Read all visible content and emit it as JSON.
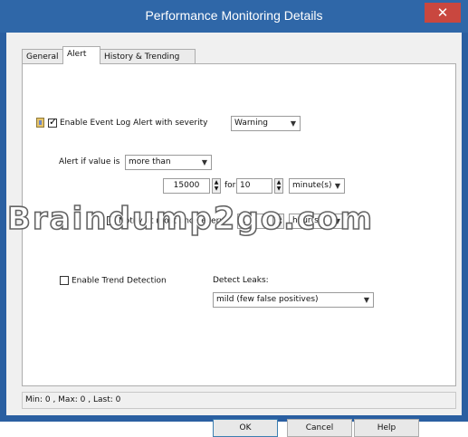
{
  "window": {
    "title": "Performance Monitoring Details",
    "close_glyph": "✕"
  },
  "tabs": [
    {
      "label": "General",
      "active": false
    },
    {
      "label": "Alert",
      "active": true
    },
    {
      "label": "History & Trending",
      "active": false
    }
  ],
  "alert": {
    "event_log_checkbox_label": "Enable Event Log Alert with severity",
    "event_log_checked": true,
    "severity_value": "Warning",
    "alert_if_label": "Alert if value is",
    "comparator_value": "more than",
    "threshold_value": "15000",
    "for_label": "for",
    "duration_value": "10",
    "duration_unit": "minute(s)",
    "notify_label": "Notify at most once every",
    "notify_checked": true,
    "notify_value": "1",
    "notify_unit": "hour(s)",
    "trend_label": "Enable Trend Detection",
    "trend_checked": false,
    "detect_leaks_label": "Detect Leaks:",
    "detect_leaks_value": "mild (few false positives)"
  },
  "watermark": "Braindump2go.com",
  "status": {
    "text": "Min: 0 , Max: 0 , Last: 0"
  },
  "buttons": {
    "ok": "OK",
    "cancel": "Cancel",
    "help": "Help"
  },
  "colors": {
    "titlebar": "#2f67a8",
    "close": "#c9473f",
    "frame": "#2a5fa1"
  }
}
